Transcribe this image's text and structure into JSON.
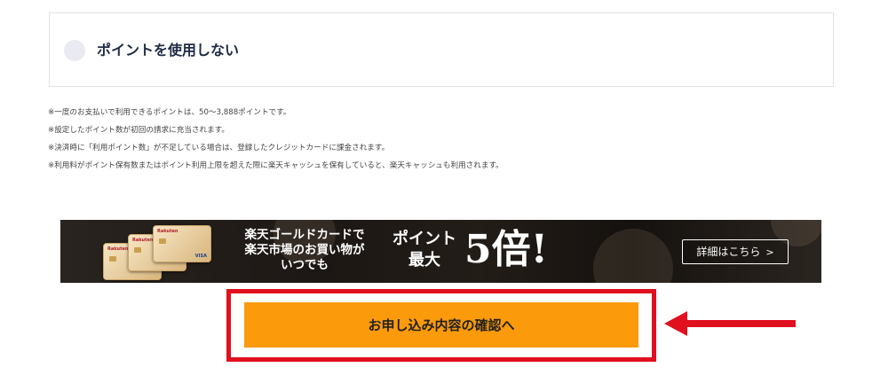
{
  "point_option": {
    "label": "ポイントを使用しない",
    "selected": false
  },
  "notes": [
    "※一度のお支払いで利用できるポイントは、50〜3,888ポイントです。",
    "※設定したポイント数が初回の請求に充当されます。",
    "※決済時に「利用ポイント数」が不足している場合は、登録したクレジットカードに課金されます。",
    "※利用料がポイント保有数またはポイント利用上限を超えた際に楽天キャッシュを保有していると、楽天キャッシュも利用されます。"
  ],
  "banner": {
    "line1": "楽天ゴールドカードで",
    "line2": "楽天市場のお買い物が",
    "line3": "いつでも",
    "point_line1": "ポイント",
    "point_line2": "最大",
    "multiplier": "5倍!",
    "details_label": "詳細はこちら",
    "card_brand": "Rakuten",
    "card_network": "VISA"
  },
  "confirm_button": {
    "label": "お申し込み内容の確認へ"
  },
  "colors": {
    "highlight": "#e0101f",
    "button": "#fb9a0b",
    "arrow": "#e0101f"
  }
}
